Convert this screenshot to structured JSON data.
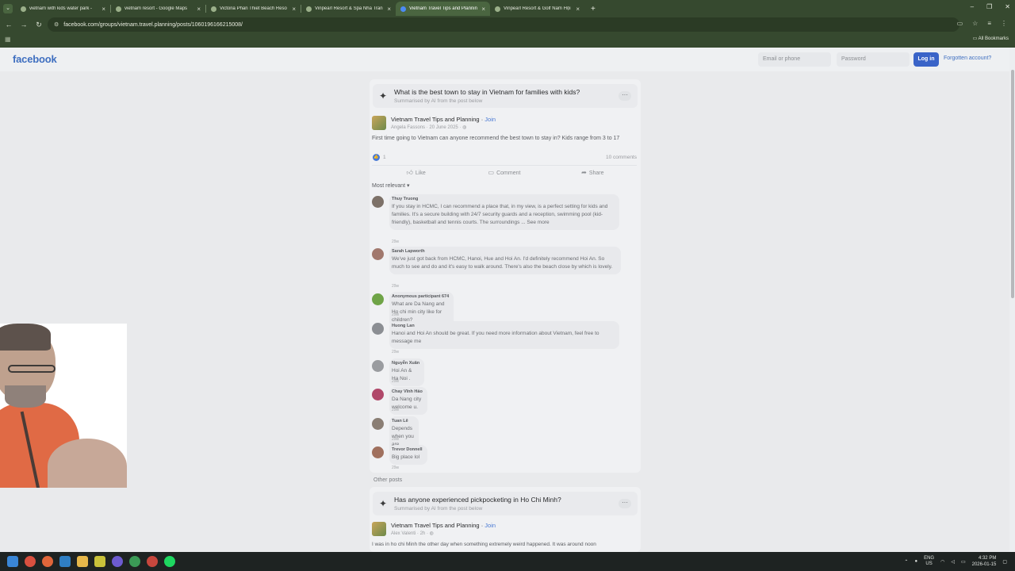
{
  "browser": {
    "tabs": [
      {
        "title": "vietnam with kids water park -"
      },
      {
        "title": "vietnam resort - Google Maps"
      },
      {
        "title": "Victoria Phan Thiet Beach Reso"
      },
      {
        "title": "Vinpearl Resort & Spa Nha Tran"
      },
      {
        "title": "Vietnam Travel Tips and Plannin"
      },
      {
        "title": "Vinpearl Resort & Golf Nam Hội"
      }
    ],
    "active_tab": 4,
    "url": "facebook.com/groups/vietnam.travel.planning/posts/1060196166215008/",
    "bookmarks_label": "All Bookmarks"
  },
  "fb": {
    "logo": "facebook",
    "email_placeholder": "Email or phone",
    "password_placeholder": "Password",
    "login_label": "Log in",
    "forgot_label": "Forgotten account?"
  },
  "post": {
    "ai_question": "What is the best town to stay in Vietnam for families with kids?",
    "ai_subtitle": "Summarised by AI from the post below",
    "group_name": "Vietnam Travel Tips and Planning",
    "join_label": "Join",
    "author": "Angela Fassons",
    "date": "20 June 2025",
    "body": "First time going to Vietnam can anyone recommend the best town to stay in? Kids range from 3 to 17",
    "like_count": "1",
    "comment_count": "10 comments",
    "actions": {
      "like": "Like",
      "comment": "Comment",
      "share": "Share"
    },
    "sort_label": "Most relevant"
  },
  "comments": [
    {
      "name": "Thuy Truong",
      "text": "If you stay in HCMC, I can recommend a place that, in my view, is a perfect setting for kids and families. It's a secure building with 24/7 security guards and a reception, swimming pool (kid-friendly), basketball and tennis courts. The surroundings ... See more",
      "time": "29w",
      "color": "#7d7168"
    },
    {
      "name": "Sarah Lapworth",
      "text": "We've just got back from HCMC, Hanoi, Hue and Hoi An. I'd definitely recommend Hoi An. So much to see and do and it's easy to walk around. There's also the beach close by which is lovely.",
      "time": "29w",
      "color": "#a1786d"
    },
    {
      "name": "Anonymous participant 674",
      "text": "What are Da Nang and Ho chi min city like for children?",
      "time": "29w",
      "color": "#6fa447"
    },
    {
      "name": "Huong Lan",
      "text": "Hanoi and Hoi An should be great. If you need more information about Vietnam, feel free to message me",
      "time": "29w",
      "color": "#8b8e93"
    },
    {
      "name": "Nguyễn Xuân",
      "text": "Hoi An & Ha Noi .",
      "time": "29w",
      "color": "#9a9ca0"
    },
    {
      "name": "Chay Vĩnh Hảo",
      "text": "Da Nang city welcome u.",
      "time": "29w",
      "color": "#b0486a"
    },
    {
      "name": "Tuan Lê",
      "text": "Depends when you are traveling?",
      "time": "29w",
      "color": "#8a7e74"
    },
    {
      "name": "Trevor Donnell",
      "text": "Big place lol",
      "time": "29w",
      "color": "#a0705e"
    }
  ],
  "other": {
    "heading": "Other posts",
    "ai_question": "Has anyone experienced pickpocketing in Ho Chi Minh?",
    "ai_subtitle": "Summarised by AI from the post below",
    "group_name": "Vietnam Travel Tips and Planning",
    "join_label": "Join",
    "author": "Alex Valenti",
    "date": "2h",
    "body": "I was in ho chi Minh the other day when something extremely weird happened. It was around noon"
  },
  "taskbar": {
    "lang_top": "ENG",
    "lang_bottom": "US",
    "time": "4:32 PM",
    "date": "2026-01-15"
  }
}
